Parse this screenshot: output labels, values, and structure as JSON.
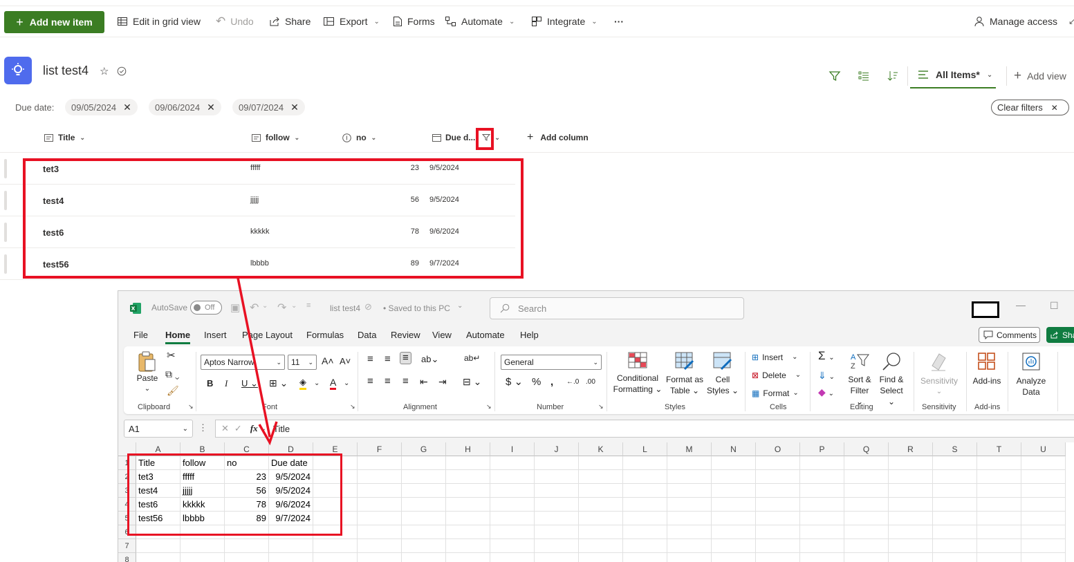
{
  "cmdbar": {
    "add_new": "Add new item",
    "edit_grid": "Edit in grid view",
    "undo": "Undo",
    "share": "Share",
    "export": "Export",
    "forms": "Forms",
    "automate": "Automate",
    "integrate": "Integrate",
    "more": "···",
    "manage_access": "Manage access"
  },
  "list": {
    "title": "list test4",
    "view_name": "All Items*",
    "add_view": "Add view",
    "filter_label": "Due date:",
    "filters": [
      "09/05/2024",
      "09/06/2024",
      "09/07/2024"
    ],
    "clear_filters": "Clear filters",
    "columns": {
      "title": "Title",
      "follow": "follow",
      "no": "no",
      "due": "Due d...",
      "add": "Add column"
    },
    "rows": [
      {
        "title": "tet3",
        "follow": "fffff",
        "no": "23",
        "due": "9/5/2024"
      },
      {
        "title": "test4",
        "follow": "jjjjj",
        "no": "56",
        "due": "9/5/2024"
      },
      {
        "title": "test6",
        "follow": "kkkkk",
        "no": "78",
        "due": "9/6/2024"
      },
      {
        "title": "test56",
        "follow": "lbbbb",
        "no": "89",
        "due": "9/7/2024"
      }
    ]
  },
  "excel": {
    "autosave": "AutoSave",
    "autosave_state": "Off",
    "doc_title": "list test4",
    "save_status": "• Saved to this PC",
    "search_placeholder": "Search",
    "tabs": [
      "File",
      "Home",
      "Insert",
      "Page Layout",
      "Formulas",
      "Data",
      "Review",
      "View",
      "Automate",
      "Help"
    ],
    "comments": "Comments",
    "share": "Sha",
    "ribbon": {
      "paste": "Paste",
      "clipboard": "Clipboard",
      "font_name": "Aptos Narrow",
      "font_size": "11",
      "font": "Font",
      "alignment": "Alignment",
      "number_format": "General",
      "number": "Number",
      "cond_fmt_1": "Conditional",
      "cond_fmt_2": "Formatting",
      "fmt_table_1": "Format as",
      "fmt_table_2": "Table",
      "cell_styles_1": "Cell",
      "cell_styles_2": "Styles",
      "styles": "Styles",
      "insert": "Insert",
      "delete": "Delete",
      "format": "Format",
      "cells": "Cells",
      "sort_1": "Sort &",
      "sort_2": "Filter",
      "find_1": "Find &",
      "find_2": "Select",
      "editing": "Editing",
      "sensitivity": "Sensitivity",
      "sensitivity_grp": "Sensitivity",
      "addins": "Add-ins",
      "addins_grp": "Add-ins",
      "analyze_1": "Analyze",
      "analyze_2": "Data"
    },
    "name_box": "A1",
    "formula_value": "Title",
    "fx": "fx",
    "columns": [
      "A",
      "B",
      "C",
      "D",
      "E",
      "F",
      "G",
      "H",
      "I",
      "J",
      "K",
      "L",
      "M",
      "N",
      "O",
      "P",
      "Q",
      "R",
      "S",
      "T",
      "U"
    ],
    "row_numbers": [
      "1",
      "2",
      "3",
      "4",
      "5",
      "6",
      "7",
      "8"
    ],
    "cells": [
      [
        "Title",
        "follow",
        "no",
        "Due date"
      ],
      [
        "tet3",
        "fffff",
        "23",
        "9/5/2024"
      ],
      [
        "test4",
        "jjjjj",
        "56",
        "9/5/2024"
      ],
      [
        "test6",
        "kkkkk",
        "78",
        "9/6/2024"
      ],
      [
        "test56",
        "lbbbb",
        "89",
        "9/7/2024"
      ]
    ]
  },
  "colors": {
    "accent_green": "#3b7d23",
    "highlight_red": "#e81123",
    "excel_green": "#107c41"
  }
}
